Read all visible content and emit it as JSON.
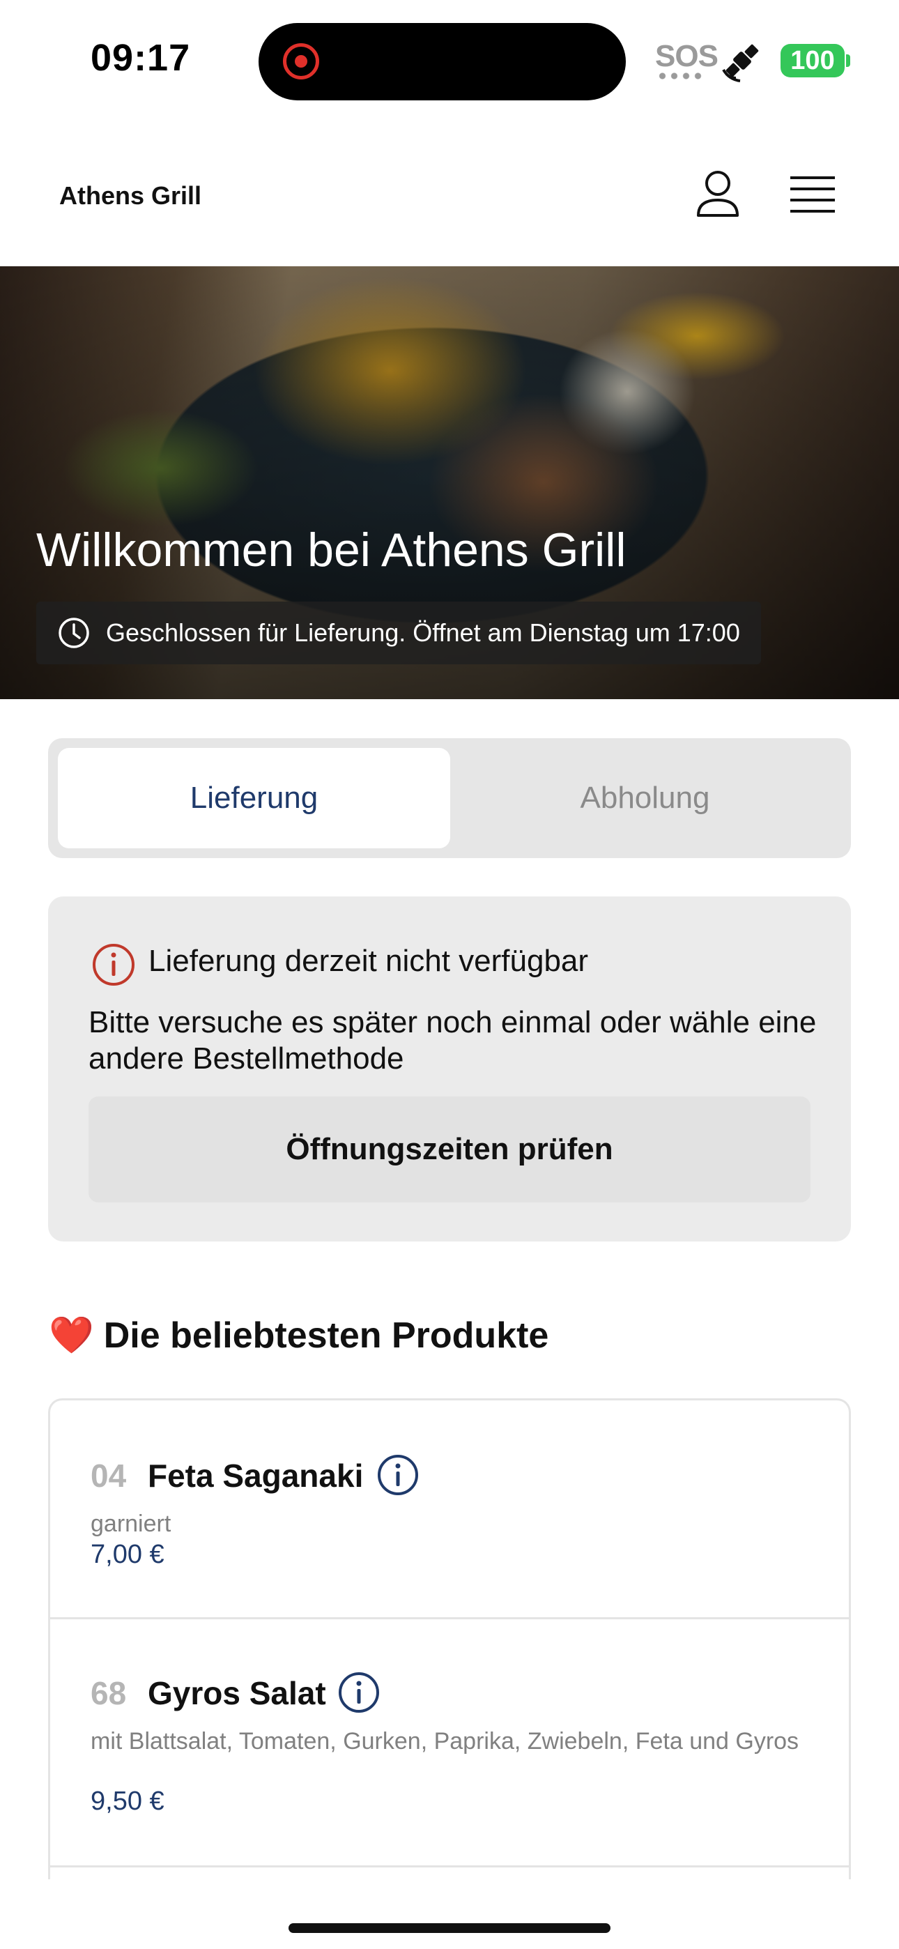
{
  "status_bar": {
    "time": "09:17",
    "sos": "SOS",
    "battery": "100",
    "icons": [
      "recording-dot-icon",
      "satellite-icon",
      "battery-icon"
    ]
  },
  "header": {
    "brand": "Athens Grill",
    "icons": [
      "user-icon",
      "menu-icon"
    ]
  },
  "hero": {
    "title": "Willkommen bei Athens Grill",
    "status": "Geschlossen für Lieferung. Öffnet am Dienstag um 17:00"
  },
  "tabs": {
    "delivery": "Lieferung",
    "pickup": "Abholung",
    "active": "delivery"
  },
  "notice": {
    "title": "Lieferung derzeit nicht verfügbar",
    "text": "Bitte versuche es später noch einmal oder wähle eine andere Bestellmethode",
    "button": "Öffnungszeiten prüfen"
  },
  "popular": {
    "title": "Die beliebtesten Produkte",
    "heart": "❤️",
    "products": [
      {
        "number": "04",
        "name": "Feta Saganaki",
        "description": "garniert",
        "price": "7,00 €"
      },
      {
        "number": "68",
        "name": "Gyros Salat",
        "description": "mit Blattsalat, Tomaten, Gurken, Paprika, Zwiebeln, Feta und Gyros",
        "price": "9,50 €"
      }
    ]
  },
  "colors": {
    "accent": "#1f3a6b",
    "battery": "#34c759",
    "alert": "#c0392b"
  }
}
